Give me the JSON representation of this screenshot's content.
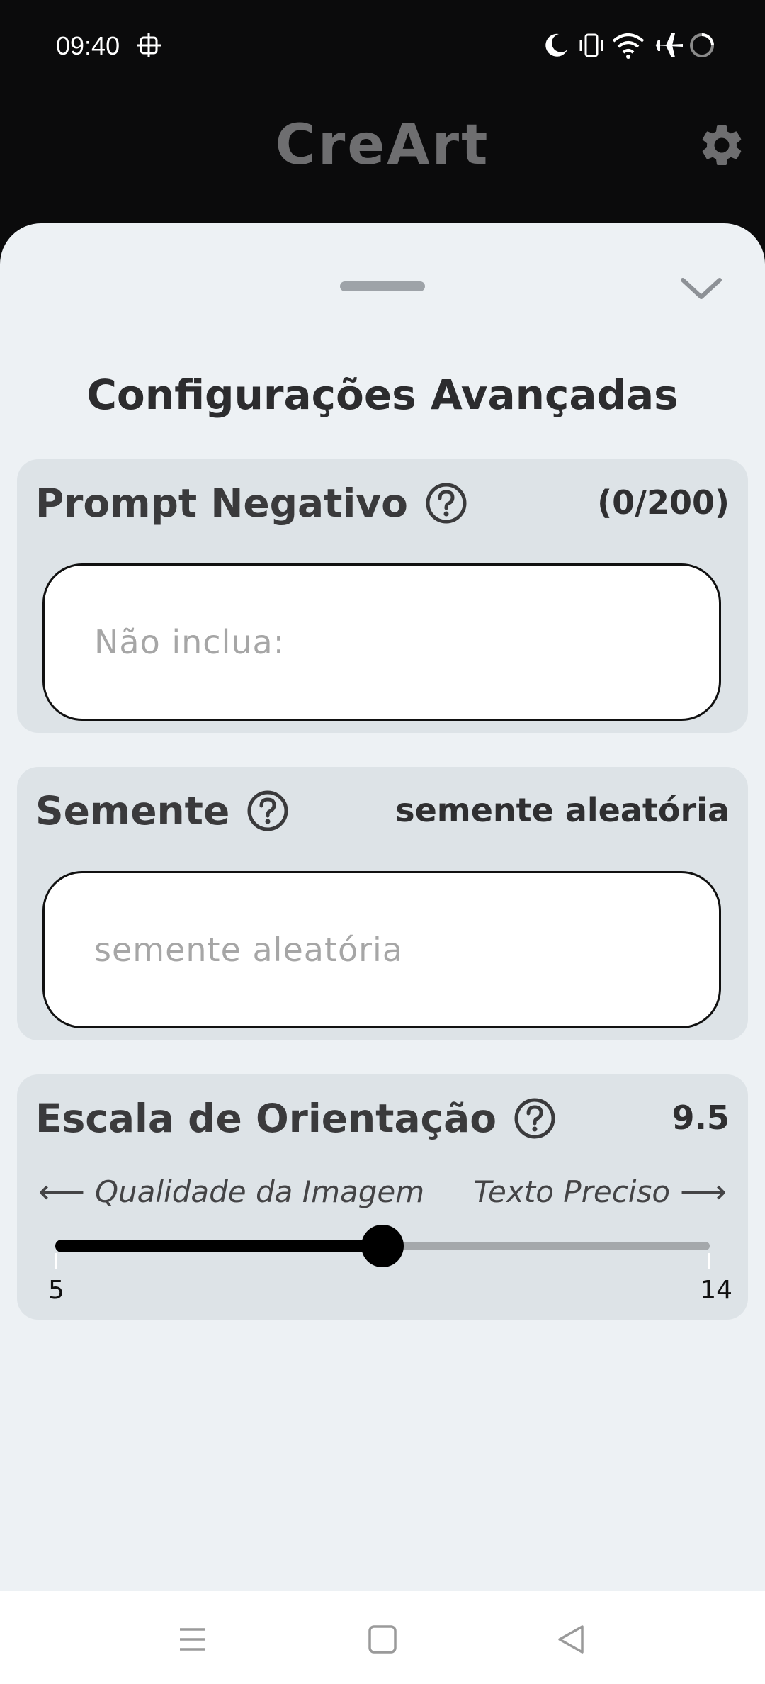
{
  "status_bar": {
    "time": "09:40"
  },
  "header": {
    "app_title": "CreArt"
  },
  "sheet": {
    "title": "Configurações Avançadas"
  },
  "negative_prompt": {
    "label": "Prompt Negativo",
    "counter": "(0/200)",
    "value": "",
    "placeholder": "Não inclua:"
  },
  "seed": {
    "label": "Semente",
    "current_value_label": "semente aleatória",
    "value": "",
    "placeholder": "semente aleatória"
  },
  "guidance_scale": {
    "label": "Escala de Orientação",
    "value": 9.5,
    "value_label": "9.5",
    "hint_left": "Qualidade da Imagem",
    "hint_right": "Texto Preciso",
    "arrow_left": "⟵",
    "arrow_right": "⟶",
    "min": 5,
    "max": 14,
    "min_label": "5",
    "max_label": "14"
  },
  "icons": {
    "settings": "gear-icon",
    "collapse": "chevron-down-icon",
    "help": "help-circle-icon",
    "nav_menu": "menu-icon",
    "nav_home": "square-icon",
    "nav_back": "triangle-back-icon"
  },
  "colors": {
    "sheet_background": "#edf1f4",
    "card_background": "#dde3e7",
    "slider_active": "#000000",
    "slider_inactive": "#a4a8ab"
  }
}
